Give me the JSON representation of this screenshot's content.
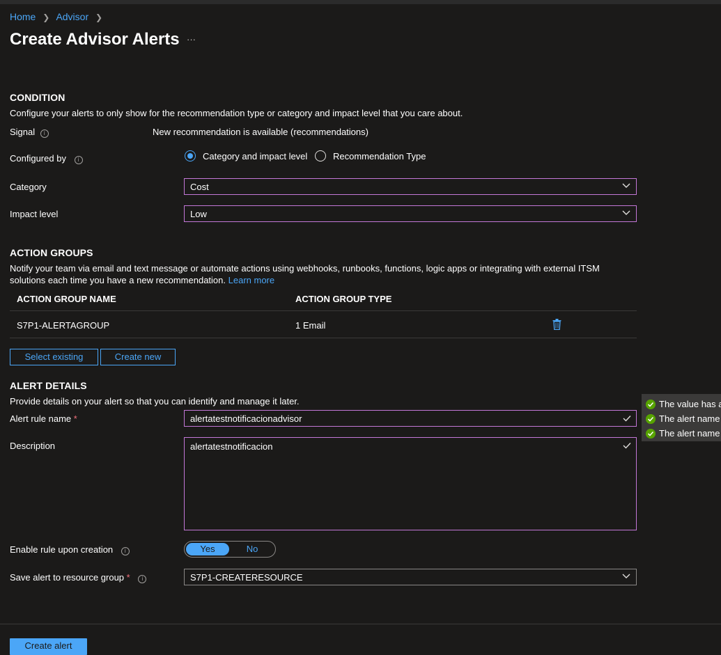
{
  "breadcrumb": {
    "home": "Home",
    "advisor": "Advisor"
  },
  "page": {
    "title": "Create Advisor Alerts",
    "more": "···"
  },
  "condition": {
    "heading": "CONDITION",
    "description": "Configure your alerts to only show for the recommendation type or category and impact level that you care about.",
    "signal_label": "Signal",
    "signal_value": "New recommendation is available (recommendations)",
    "configured_by_label": "Configured by",
    "options": [
      "Category and impact level",
      "Recommendation Type"
    ],
    "selected_option": "Category and impact level",
    "category_label": "Category",
    "category_value": "Cost",
    "impact_label": "Impact level",
    "impact_value": "Low"
  },
  "action_groups": {
    "heading": "ACTION GROUPS",
    "description_line1": "Notify your team via email and text message or automate actions using webhooks, runbooks, functions, logic apps or integrating with external ITSM",
    "description_line2": "solutions each time you have a new recommendation.",
    "learn_more": "Learn more",
    "columns": [
      "ACTION GROUP NAME",
      "ACTION GROUP TYPE"
    ],
    "rows": [
      {
        "name": "S7P1-ALERTAGROUP",
        "type": "1 Email"
      }
    ],
    "select_existing": "Select existing",
    "create_new": "Create new"
  },
  "alert_details": {
    "heading": "ALERT DETAILS",
    "description": "Provide details on your alert so that you can identify and manage it later.",
    "rule_name_label": "Alert rule name",
    "rule_name_value": "alertatestnotificacionadvisor",
    "required_mark": "*",
    "description_label": "Description",
    "description_value": "alertatestnotificacion",
    "enable_label": "Enable rule upon creation",
    "toggle_yes": "Yes",
    "toggle_no": "No",
    "toggle_selected": "Yes",
    "resource_group_label": "Save alert to resource group",
    "resource_group_value": "S7P1-CREATERESOURCE"
  },
  "validation_tooltip": {
    "lines": [
      "The value has a",
      "The alert name",
      "The alert name"
    ]
  },
  "footer": {
    "create_button": "Create alert"
  },
  "colors": {
    "accent": "#4ba6f7",
    "field_border": "#c478d8",
    "success": "#57a300",
    "background": "#1b1a19"
  }
}
